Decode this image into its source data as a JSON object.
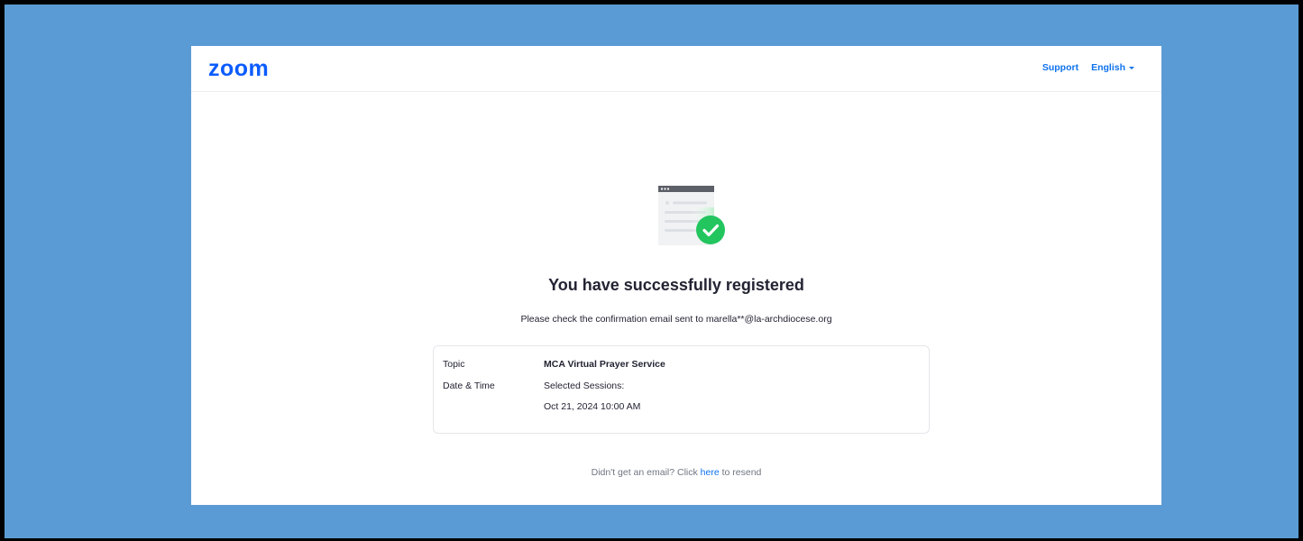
{
  "header": {
    "logo_text": "zoom",
    "support_label": "Support",
    "language_label": "English"
  },
  "main": {
    "title": "You have successfully registered",
    "confirmation_text": "Please check the confirmation email sent to marella**@la-archdiocese.org",
    "details": {
      "topic_label": "Topic",
      "topic_value": "MCA Virtual Prayer Service",
      "datetime_label": "Date & Time",
      "sessions_label": "Selected Sessions:",
      "session_value": "Oct 21, 2024 10:00 AM"
    },
    "resend": {
      "prefix": "Didn't get an email? Click",
      "link": "here",
      "suffix": "to resend"
    }
  },
  "colors": {
    "frame_bg": "#5b9bd5",
    "brand_blue": "#0b5cff",
    "link_blue": "#0e72ed",
    "success_green": "#22c55e"
  },
  "icons": {
    "illustration": "browser-window-check-icon",
    "caret": "caret-down-icon"
  }
}
